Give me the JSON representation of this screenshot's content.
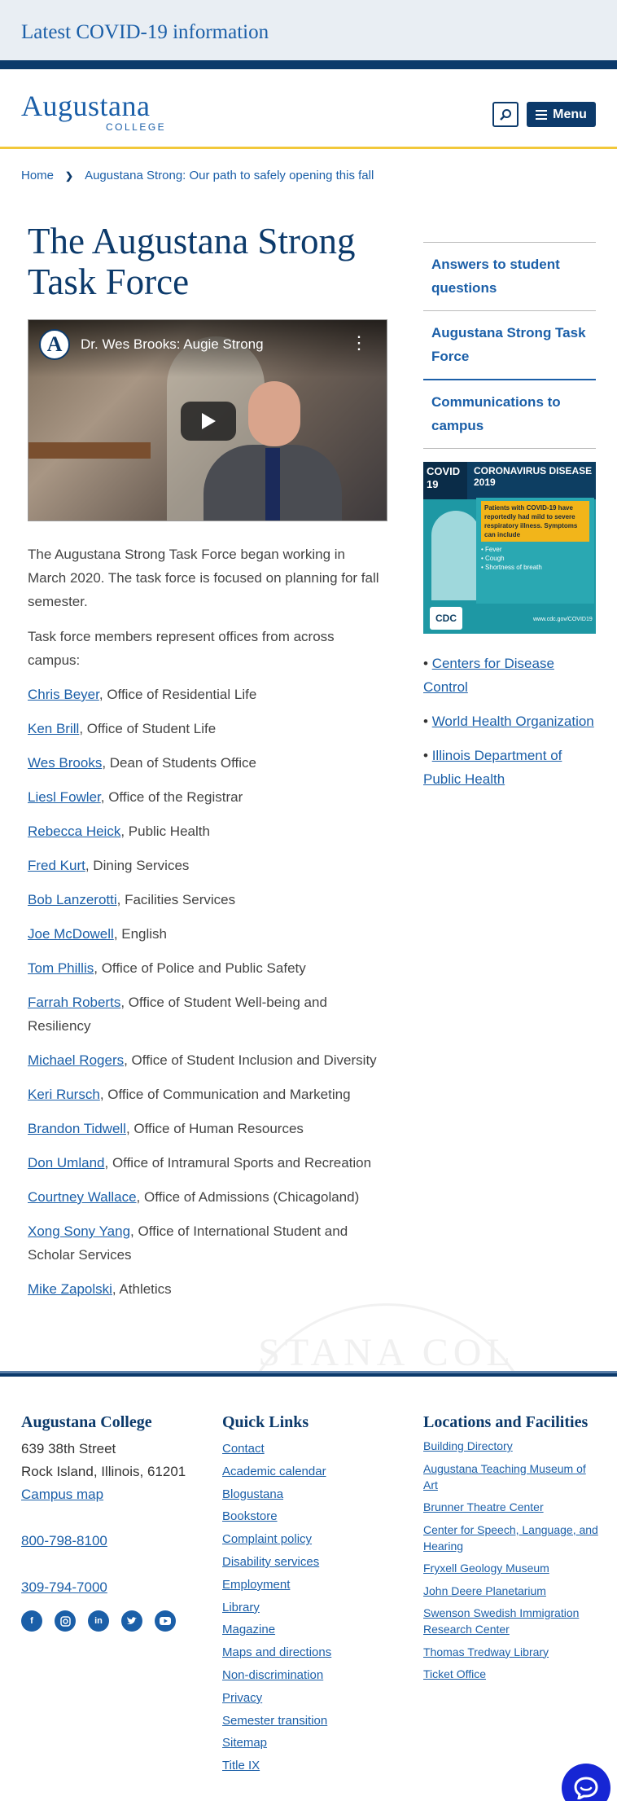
{
  "alert": {
    "text": "Latest COVID-19 information"
  },
  "header": {
    "logo_word": "Augustana",
    "logo_sub": "COLLEGE",
    "menu_label": "Menu",
    "icons": {
      "search": "search-icon",
      "menu": "hamburger-icon"
    }
  },
  "breadcrumb": {
    "home": "Home",
    "current": "Augustana Strong: Our path to safely opening this fall"
  },
  "main": {
    "title": "The Augustana Strong Task Force",
    "video": {
      "avatar_letter": "A",
      "title": "Dr. Wes Brooks: Augie Strong"
    },
    "intro": [
      "The Augustana Strong Task Force began working in March 2020. The task force is focused on planning for fall semester.",
      "Task force members represent offices from across campus:"
    ],
    "members": [
      {
        "name": "Chris Beyer",
        "office": ", Office of Residential Life"
      },
      {
        "name": "Ken Brill",
        "office": ", Office of Student Life"
      },
      {
        "name": "Wes Brooks",
        "office": ", Dean of Students Office"
      },
      {
        "name": "Liesl Fowler",
        "office": ", Office of the Registrar"
      },
      {
        "name": "Rebecca Heick",
        "office": ", Public Health"
      },
      {
        "name": "Fred Kurt",
        "office": ", Dining Services"
      },
      {
        "name": "Bob Lanzerotti",
        "office": ", Facilities Services"
      },
      {
        "name": "Joe McDowell",
        "office": ", English"
      },
      {
        "name": "Tom Phillis",
        "office": ", Office of Police and Public Safety"
      },
      {
        "name": "Farrah Roberts",
        "office": ", Office of Student Well-being and Resiliency"
      },
      {
        "name": "Michael Rogers",
        "office": ", Office of Student Inclusion and Diversity"
      },
      {
        "name": "Keri Rursch",
        "office": ", Office of Communication and Marketing"
      },
      {
        "name": "Brandon Tidwell",
        "office": ", Office of Human Resources"
      },
      {
        "name": "Don Umland",
        "office": ", Office of Intramural Sports and Recreation"
      },
      {
        "name": "Courtney Wallace",
        "office": ", Office of Admissions (Chicagoland)"
      },
      {
        "name": "Xong Sony Yang",
        "office": ", Office of International Student and Scholar Services"
      },
      {
        "name": "Mike Zapolski",
        "office": ", Athletics"
      }
    ]
  },
  "sidebar": {
    "links": [
      "Answers to student questions",
      "Augustana Strong Task Force",
      "Communications to campus"
    ],
    "cdc_poster": {
      "badge": "COVID 19",
      "heading": "CORONAVIRUS DISEASE 2019",
      "highlight": "Patients with COVID-19 have reportedly had mild to severe respiratory illness. Symptoms can include",
      "symptoms": [
        "Fever",
        "Cough",
        "Shortness of breath"
      ],
      "logo": "CDC",
      "url": "www.cdc.gov/COVID19"
    },
    "resources": [
      "Centers for Disease Control",
      "World Health Organization",
      "Illinois Department of Public Health"
    ]
  },
  "footer": {
    "college": {
      "heading": "Augustana College",
      "street": "639 38th Street",
      "city": "Rock Island, Illinois, 61201",
      "map": "Campus map",
      "phone1": "800-798-8100",
      "phone2": "309-794-7000"
    },
    "quick_links": {
      "heading": "Quick Links",
      "items": [
        "Contact",
        "Academic calendar",
        "Blogustana",
        "Bookstore",
        "Complaint policy",
        "Disability services",
        "Employment",
        "Library",
        "Magazine",
        "Maps and directions",
        "Non-discrimination",
        "Privacy",
        "Semester transition",
        "Sitemap",
        "Title IX"
      ]
    },
    "locations": {
      "heading": "Locations and Facilities",
      "items": [
        "Building Directory",
        "Augustana Teaching Museum of Art",
        "Brunner Theatre Center",
        "Center for Speech, Language, and Hearing",
        "Fryxell Geology Museum",
        "John Deere Planetarium",
        "Swenson Swedish Immigration Research Center",
        "Thomas Tredway Library",
        "Ticket Office"
      ]
    },
    "socials": [
      "facebook-icon",
      "instagram-icon",
      "linkedin-icon",
      "twitter-icon",
      "youtube-icon"
    ]
  },
  "colors": {
    "navy": "#0c3a6b",
    "link": "#1b5fa8",
    "gold": "#f2c83a",
    "chat": "#1626d4"
  }
}
